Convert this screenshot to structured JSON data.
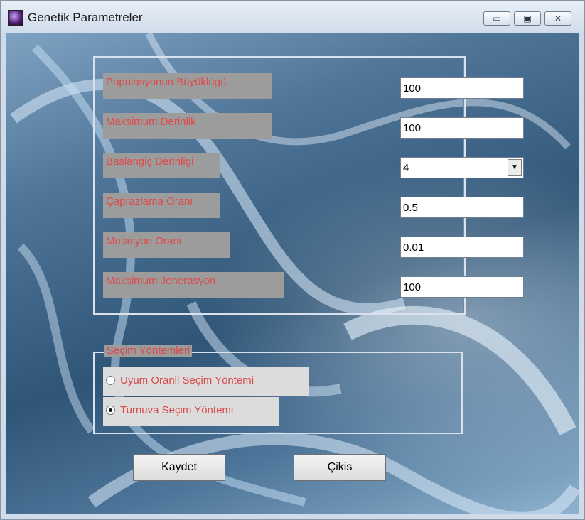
{
  "window": {
    "title": "Genetik Parametreler",
    "controls": {
      "minimize_glyph": "▭",
      "maximize_glyph": "▣",
      "close_glyph": "✕"
    }
  },
  "params": [
    {
      "label": "Popülasyonun Büyüklügü",
      "value": "100",
      "type": "input"
    },
    {
      "label": "Maksimum Derinlik",
      "value": "100",
      "type": "input"
    },
    {
      "label": "Baslangiç Derinligi",
      "value": "4",
      "type": "select"
    },
    {
      "label": "Çaprazlama Orani",
      "value": "0.5",
      "type": "input"
    },
    {
      "label": "Mutasyon Orani",
      "value": "0.01",
      "type": "input"
    },
    {
      "label": "Maksimum Jenerasyon",
      "value": "100",
      "type": "input"
    }
  ],
  "selection": {
    "title": "Seçim Yöntemleri",
    "options": [
      {
        "label": "Uyum Oranli Seçim Yöntemi",
        "selected": false
      },
      {
        "label": "Turnuva Seçim Yöntemi",
        "selected": true
      }
    ]
  },
  "buttons": {
    "save": "Kaydet",
    "exit": "Çikis"
  },
  "colors": {
    "label_text": "#e04a4a",
    "label_bg": "#9c9c9c",
    "background": "#3f6789"
  },
  "icons": {
    "app": "dna-app-icon",
    "dropdown": "chevron-down-icon"
  }
}
